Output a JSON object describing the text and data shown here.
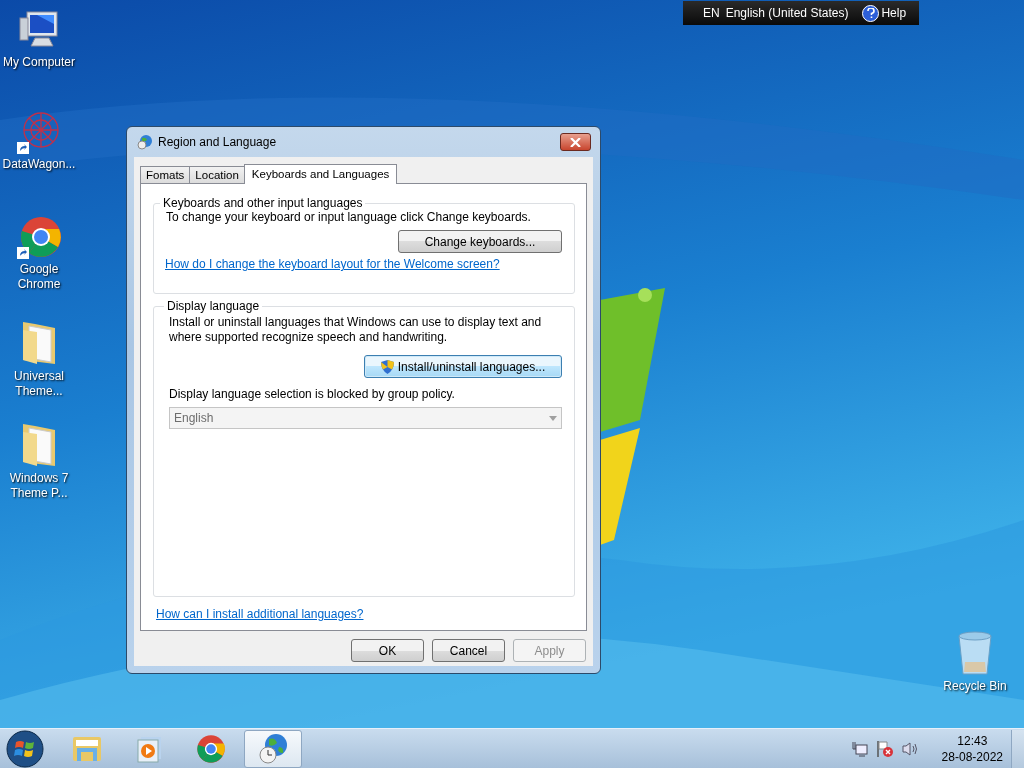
{
  "desktop_icons": [
    {
      "label": "My Computer",
      "kind": "computer",
      "shortcut": false
    },
    {
      "label": "DataWagon...",
      "kind": "web",
      "shortcut": true
    },
    {
      "label": "Google Chrome",
      "kind": "chrome",
      "shortcut": true
    },
    {
      "label": "Universal Theme...",
      "kind": "folder",
      "shortcut": false
    },
    {
      "label": "Windows 7 Theme P...",
      "kind": "folder",
      "shortcut": false
    }
  ],
  "recycle_bin": {
    "label": "Recycle Bin"
  },
  "language_bar": {
    "code": "EN",
    "language": "English (United States)",
    "help": "Help"
  },
  "dialog": {
    "title": "Region and Language",
    "tabs": [
      {
        "label": "Fomats",
        "selected": false
      },
      {
        "label": "Location",
        "selected": false
      },
      {
        "label": "Keyboards and Languages",
        "selected": true
      }
    ],
    "keyboards_group": {
      "title": "Keyboards and other input languages",
      "text": "To change your keyboard or input language click Change keyboards.",
      "button": "Change keyboards...",
      "link": "How do I change the keyboard layout for the Welcome screen?"
    },
    "display_group": {
      "title": "Display language",
      "text": "Install or uninstall languages that Windows can use to display text and where supported recognize speech and handwriting.",
      "button": {
        "label": "Install/uninstall languages...",
        "focused": true
      },
      "note": "Display language selection is blocked by group policy.",
      "dropdown": {
        "value": "English",
        "disabled": true
      }
    },
    "link": "How can I install additional languages?",
    "buttons": [
      {
        "label": "OK",
        "disabled": false
      },
      {
        "label": "Cancel",
        "disabled": false
      },
      {
        "label": "Apply",
        "disabled": true
      }
    ]
  },
  "taskbar": {
    "items": [
      {
        "kind": "explorer",
        "selected": false
      },
      {
        "kind": "media",
        "selected": false
      },
      {
        "kind": "chrome",
        "selected": false
      },
      {
        "kind": "region",
        "selected": true
      }
    ],
    "clock": {
      "time": "12:43",
      "date": "28-08-2022"
    }
  }
}
